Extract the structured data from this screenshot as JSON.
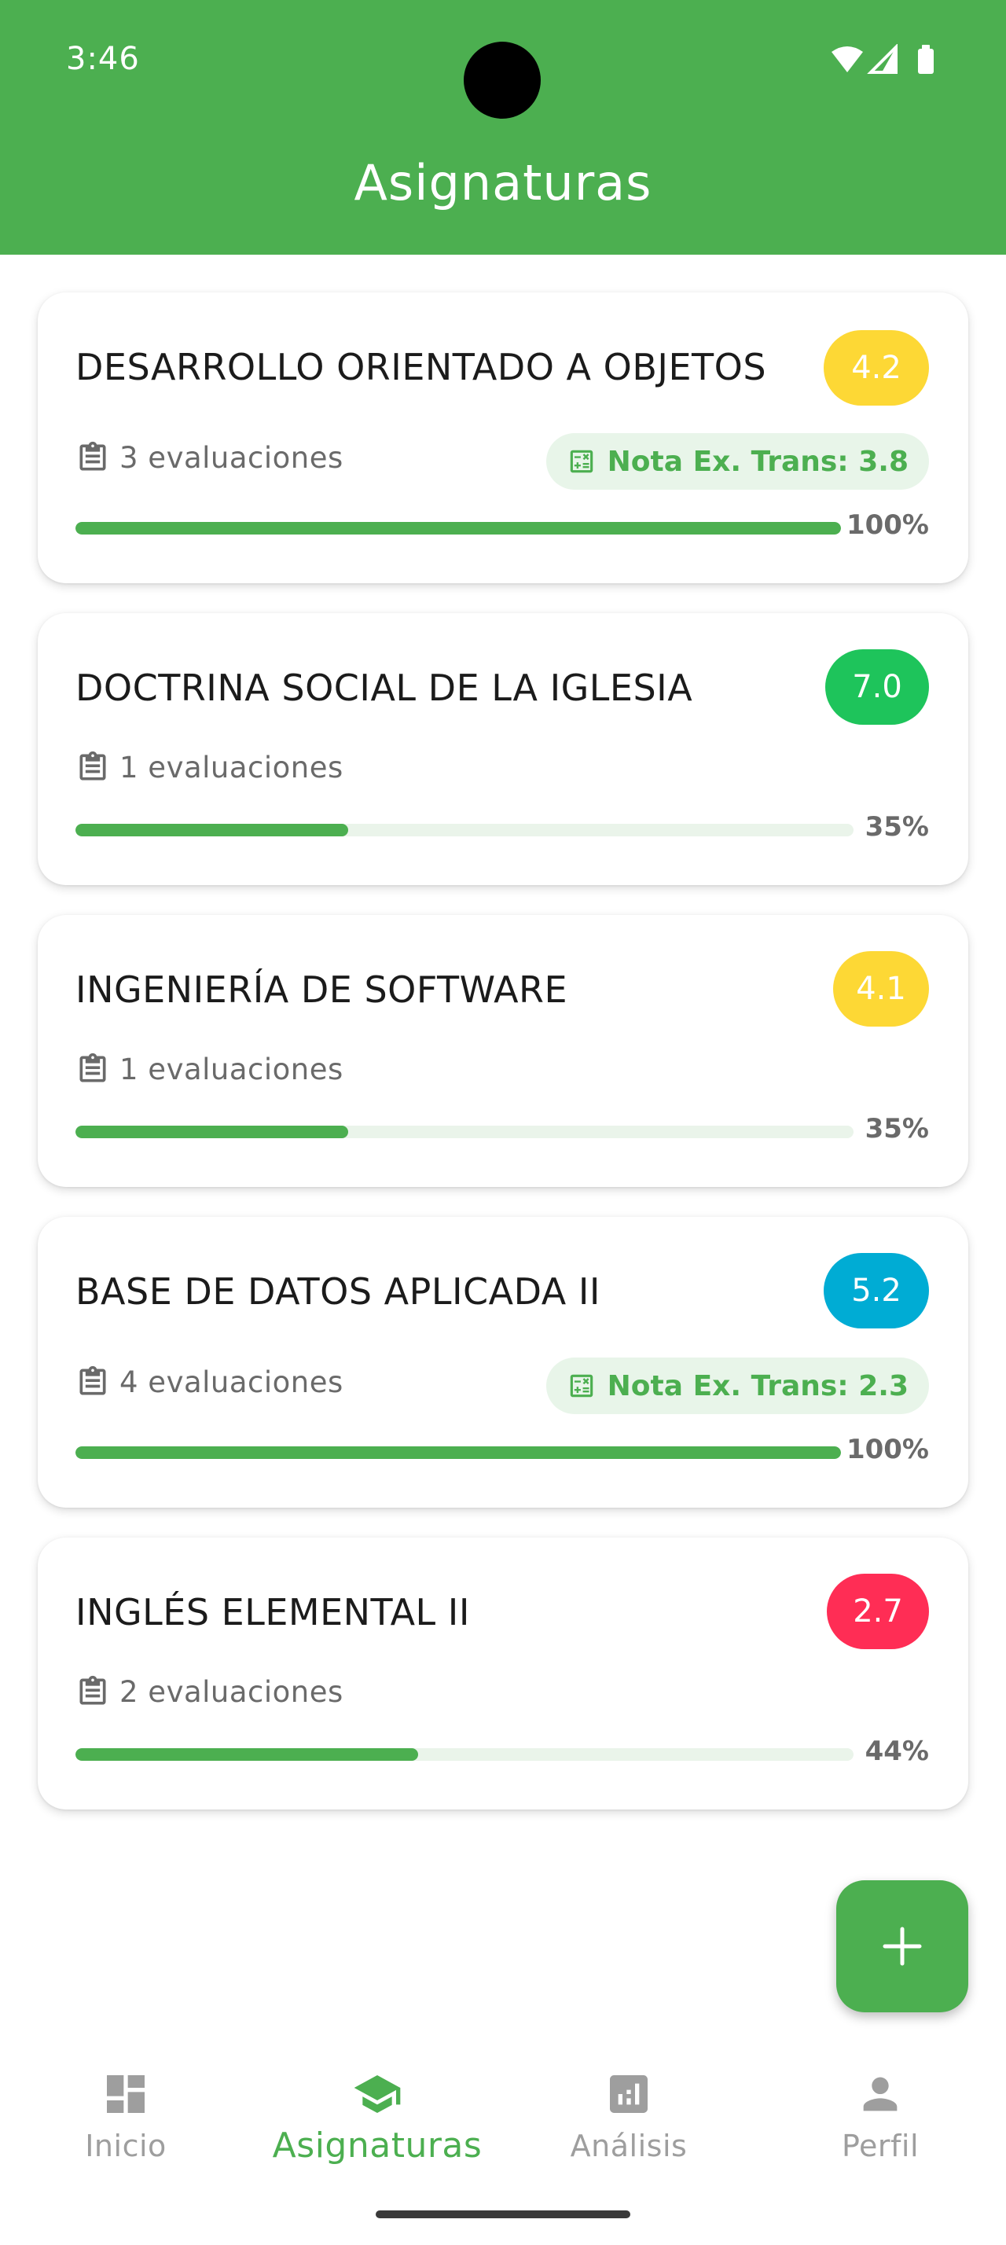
{
  "status_bar": {
    "time": "3:46"
  },
  "app_bar": {
    "title": "Asignaturas"
  },
  "subjects": [
    {
      "name": "DESARROLLO ORIENTADO A OBJETOS",
      "grade": "4.2",
      "grade_color": "#fdd835",
      "evaluations": "3 evaluaciones",
      "transition_grade": "Nota Ex. Trans: 3.8",
      "progress": 1.0,
      "progress_label": "100%"
    },
    {
      "name": "DOCTRINA SOCIAL DE LA IGLESIA",
      "grade": "7.0",
      "grade_color": "#1ec45b",
      "evaluations": "1 evaluaciones",
      "progress": 0.35,
      "progress_label": "35%"
    },
    {
      "name": "INGENIERÍA DE SOFTWARE",
      "grade": "4.1",
      "grade_color": "#fdd835",
      "evaluations": "1 evaluaciones",
      "progress": 0.35,
      "progress_label": "35%"
    },
    {
      "name": "BASE DE DATOS APLICADA II",
      "grade": "5.2",
      "grade_color": "#00acd4",
      "evaluations": "4 evaluaciones",
      "transition_grade": "Nota Ex. Trans: 2.3",
      "progress": 1.0,
      "progress_label": "100%"
    },
    {
      "name": "INGLÉS ELEMENTAL II",
      "grade": "2.7",
      "grade_color": "#ff2d55",
      "evaluations": "2 evaluaciones",
      "progress": 0.44,
      "progress_label": "44%"
    }
  ],
  "fab": {
    "icon": "plus-icon"
  },
  "bottom_nav": [
    {
      "label": "Inicio",
      "icon": "dashboard-icon",
      "active": false
    },
    {
      "label": "Asignaturas",
      "icon": "school-icon",
      "active": true
    },
    {
      "label": "Análisis",
      "icon": "analytics-icon",
      "active": false
    },
    {
      "label": "Perfil",
      "icon": "person-icon",
      "active": false
    }
  ],
  "colors": {
    "primary": "#4caf50",
    "track": "#eaf4ea",
    "chip_bg": "#e8f5e9",
    "inactive": "#9e9e9e"
  }
}
